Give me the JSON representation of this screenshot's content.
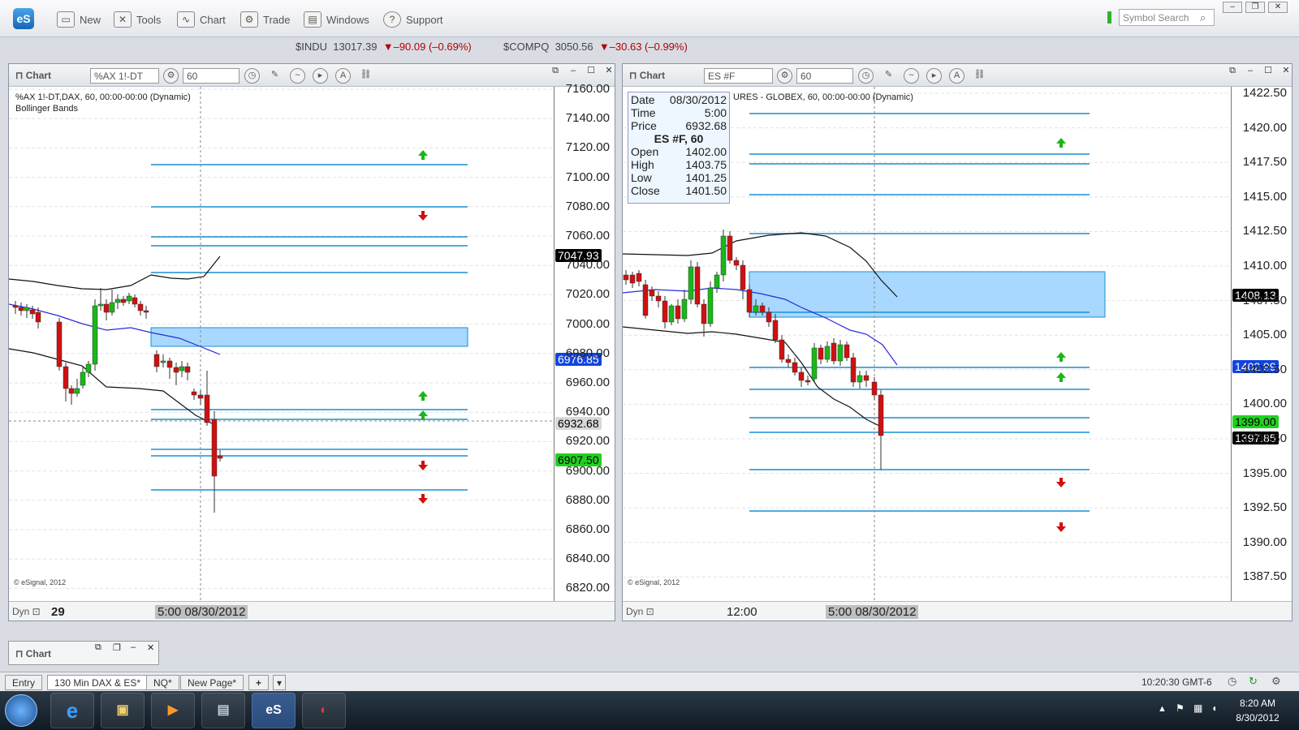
{
  "toolbar": {
    "logo": "eS",
    "items": [
      {
        "label": "New",
        "icon": "new-icon"
      },
      {
        "label": "Tools",
        "icon": "tools-icon"
      },
      {
        "label": "Chart",
        "icon": "chart-icon"
      },
      {
        "label": "Trade",
        "icon": "trade-icon"
      },
      {
        "label": "Windows",
        "icon": "windows-icon"
      },
      {
        "label": "Support",
        "icon": "support-icon"
      }
    ],
    "search_placeholder": "Symbol Search"
  },
  "ticker": {
    "indu_symbol": "$INDU",
    "indu_price": "13017.39",
    "indu_change": "▼–90.09 (–0.69%)",
    "compq_symbol": "$COMPQ",
    "compq_price": "3050.56",
    "compq_change": "▼–30.63 (–0.99%)"
  },
  "left_chart": {
    "title": "Chart",
    "symbol": "%AX 1!-DT",
    "interval": "60",
    "study_line1": "%AX 1!-DT,DAX, 60, 00:00-00:00 (Dynamic)",
    "study_line2": "Bollinger Bands",
    "yticks": [
      "7160.00",
      "7140.00",
      "7120.00",
      "7100.00",
      "7080.00",
      "7060.00",
      "7040.00",
      "7020.00",
      "7000.00",
      "6980.00",
      "6960.00",
      "6940.00",
      "6920.00",
      "6900.00",
      "6880.00",
      "6860.00",
      "6840.00",
      "6820.00"
    ],
    "price_labels": {
      "upper": "7047.93",
      "mid": "6976.85",
      "cursor": "6932.68",
      "last": "6907.50"
    },
    "footer_dyn": "Dyn",
    "footer_day": "29",
    "footer_time": "5:00 08/30/2012",
    "credit": "© eSignal, 2012"
  },
  "right_chart": {
    "title": "Chart",
    "symbol": "ES #F",
    "interval": "60",
    "study_line1": "URES - GLOBEX, 60, 00:00-00:00 (Dynamic)",
    "info": {
      "date_label": "Date",
      "date_value": "08/30/2012",
      "time_label": "Time",
      "time_value": "5:00",
      "price_label": "Price",
      "price_value": "6932.68",
      "header": "ES #F, 60",
      "open_label": "Open",
      "open_value": "1402.00",
      "high_label": "High",
      "high_value": "1403.75",
      "low_label": "Low",
      "low_value": "1401.25",
      "close_label": "Close",
      "close_value": "1401.50"
    },
    "yticks": [
      "1422.50",
      "1420.00",
      "1417.50",
      "1415.00",
      "1412.50",
      "1410.00",
      "1407.50",
      "1405.00",
      "1402.50",
      "1400.00",
      "1397.50",
      "1395.00",
      "1392.50",
      "1390.00",
      "1387.50"
    ],
    "price_labels": {
      "upper": "1408.13",
      "mid": "1402.99",
      "last": "1399.00",
      "other": "1397.85"
    },
    "footer_dyn": "Dyn",
    "footer_t1": "12:00",
    "footer_time": "5:00 08/30/2012",
    "credit": "© eSignal, 2012"
  },
  "mini_window": {
    "title": "Chart"
  },
  "tabs": [
    "Entry",
    "130 Min DAX & ES*",
    "NQ*",
    "New Page*",
    "+"
  ],
  "status": {
    "time": "10:20:30 GMT-6"
  },
  "taskbar": {
    "apps": [
      "start",
      "ie",
      "explorer",
      "media",
      "computer",
      "eS",
      "app"
    ],
    "clock_time": "8:20 AM",
    "clock_date": "8/30/2012"
  },
  "colors": {
    "up": "#18b818",
    "down": "#d01010",
    "level": "#1a8fd0",
    "zone": "#a8d8ff",
    "bb": "#111111",
    "ma": "#2a2adc"
  }
}
